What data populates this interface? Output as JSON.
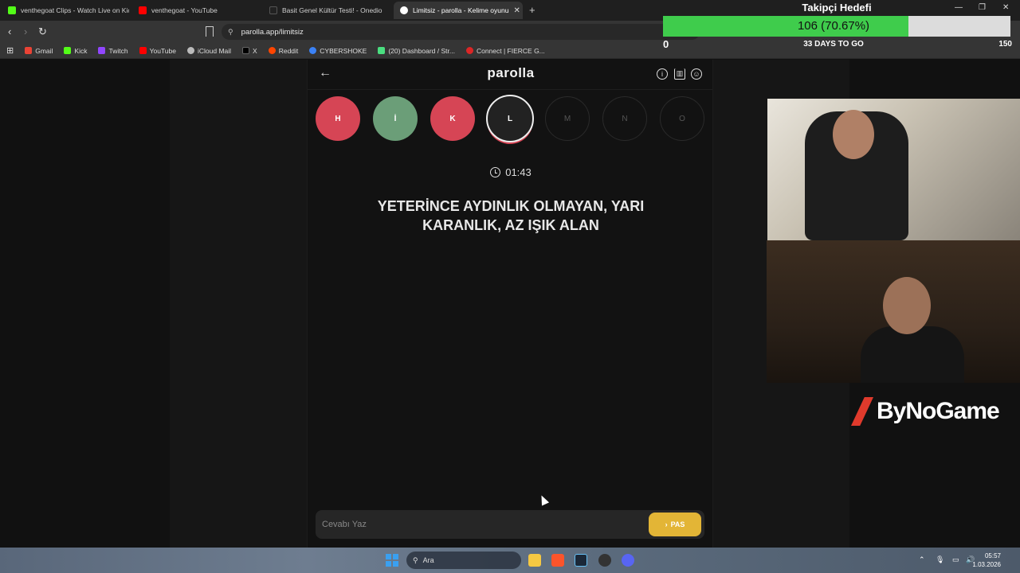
{
  "browser": {
    "tabs": [
      {
        "title": "venthegoat Clips - Watch Live on Kick",
        "favicon_color": "#53fc18",
        "active": false
      },
      {
        "title": "venthegoat - YouTube",
        "favicon_color": "#ff0000",
        "active": false
      },
      {
        "title": "Basit Genel Kültür Testi! - Onedio",
        "favicon_color": "#222222",
        "active": false
      },
      {
        "title": "Limitsiz - parolla - Kelime oyunu",
        "favicon_color": "#ffffff",
        "active": true
      }
    ],
    "address": "parolla.app/limitsiz",
    "bookmarks": [
      {
        "label": "Gmail",
        "color": "#ea4335"
      },
      {
        "label": "Kick",
        "color": "#53fc18"
      },
      {
        "label": "Twitch",
        "color": "#9146ff"
      },
      {
        "label": "YouTube",
        "color": "#ff0000"
      },
      {
        "label": "iCloud Mail",
        "color": "#bbbbbb"
      },
      {
        "label": "X",
        "color": "#000000"
      },
      {
        "label": "Reddit",
        "color": "#ff4500"
      },
      {
        "label": "CYBERSHOKE",
        "color": "#3b82f6"
      },
      {
        "label": "(20) Dashboard / Str...",
        "color": "#4ade80"
      },
      {
        "label": "Connect | FIERCE G...",
        "color": "#dc2626"
      }
    ]
  },
  "app": {
    "logo": "parolla",
    "letters": [
      {
        "char": "H",
        "state": "wrong"
      },
      {
        "char": "İ",
        "state": "correct"
      },
      {
        "char": "K",
        "state": "wrong"
      },
      {
        "char": "L",
        "state": "current"
      },
      {
        "char": "M",
        "state": "pending"
      },
      {
        "char": "N",
        "state": "pending"
      },
      {
        "char": "O",
        "state": "pending"
      }
    ],
    "timer": "01:43",
    "question_line1": "YETERİNCE AYDINLIK OLMAYAN, YARI",
    "question_line2": "KARANLIK, AZ IŞIK ALAN",
    "answer_placeholder": "Cevabı Yaz",
    "pass_label": "PAS",
    "colors": {
      "wrong": "#d64555",
      "correct": "#6b9e78",
      "pass": "#e3b536"
    }
  },
  "overlay": {
    "goal_title": "Takipçi Hedefi",
    "goal_text": "106 (70.67%)",
    "goal_progress": 0.7067,
    "goal_min": "0",
    "goal_days": "33 DAYS TO GO",
    "goal_max": "150",
    "sponsor": "ByNoGame"
  },
  "taskbar": {
    "search_label": "Ara",
    "time": "05:57",
    "date": "1.03.2026"
  }
}
